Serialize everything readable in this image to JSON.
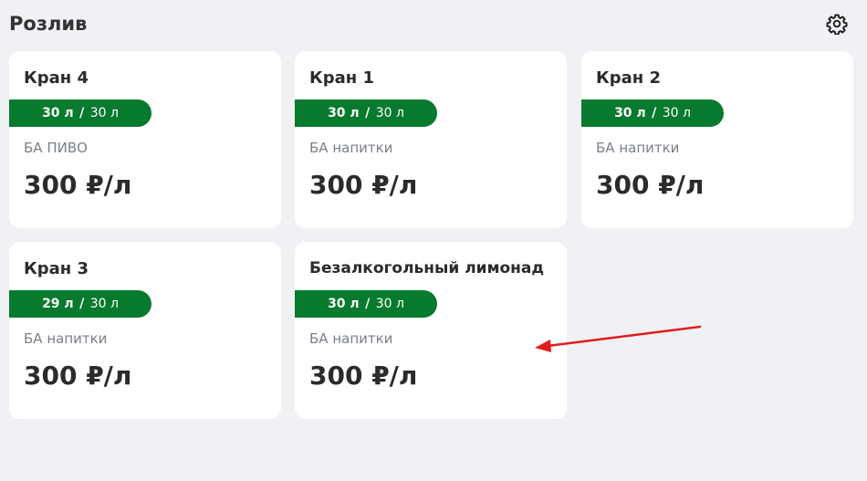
{
  "header": {
    "title": "Розлив",
    "settings_icon": "gear-icon"
  },
  "taps": [
    {
      "name": "Кран 4",
      "current": "30 л",
      "total": "30 л",
      "description": "БА ПИВО",
      "price": "300 ₽/л"
    },
    {
      "name": "Кран 1",
      "current": "30 л",
      "total": "30 л",
      "description": "БА напитки",
      "price": "300 ₽/л"
    },
    {
      "name": "Кран 2",
      "current": "30 л",
      "total": "30 л",
      "description": "БА напитки",
      "price": "300 ₽/л"
    },
    {
      "name": "Кран 3",
      "current": "29 л",
      "total": "30 л",
      "description": "БА напитки",
      "price": "300 ₽/л"
    },
    {
      "name": "Безалкогольный лимонад",
      "current": "30 л",
      "total": "30 л",
      "description": "БА напитки",
      "price": "300 ₽/л"
    }
  ],
  "volume_separator": "/",
  "colors": {
    "accent_green": "#087a2d",
    "annotation_arrow": "#e01b1b"
  }
}
